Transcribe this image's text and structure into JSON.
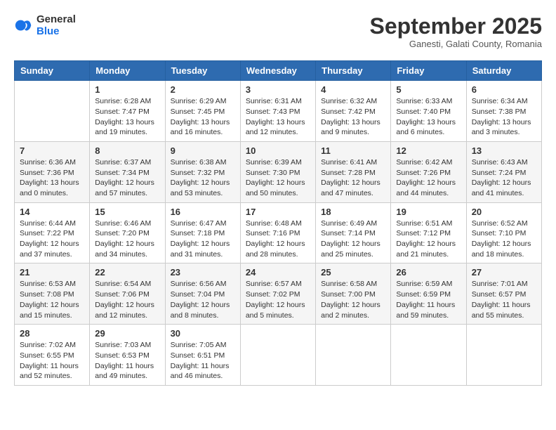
{
  "logo": {
    "general": "General",
    "blue": "Blue"
  },
  "title": "September 2025",
  "subtitle": "Ganesti, Galati County, Romania",
  "days_of_week": [
    "Sunday",
    "Monday",
    "Tuesday",
    "Wednesday",
    "Thursday",
    "Friday",
    "Saturday"
  ],
  "weeks": [
    [
      {
        "day": "",
        "info": ""
      },
      {
        "day": "1",
        "info": "Sunrise: 6:28 AM\nSunset: 7:47 PM\nDaylight: 13 hours\nand 19 minutes."
      },
      {
        "day": "2",
        "info": "Sunrise: 6:29 AM\nSunset: 7:45 PM\nDaylight: 13 hours\nand 16 minutes."
      },
      {
        "day": "3",
        "info": "Sunrise: 6:31 AM\nSunset: 7:43 PM\nDaylight: 13 hours\nand 12 minutes."
      },
      {
        "day": "4",
        "info": "Sunrise: 6:32 AM\nSunset: 7:42 PM\nDaylight: 13 hours\nand 9 minutes."
      },
      {
        "day": "5",
        "info": "Sunrise: 6:33 AM\nSunset: 7:40 PM\nDaylight: 13 hours\nand 6 minutes."
      },
      {
        "day": "6",
        "info": "Sunrise: 6:34 AM\nSunset: 7:38 PM\nDaylight: 13 hours\nand 3 minutes."
      }
    ],
    [
      {
        "day": "7",
        "info": "Sunrise: 6:36 AM\nSunset: 7:36 PM\nDaylight: 13 hours\nand 0 minutes."
      },
      {
        "day": "8",
        "info": "Sunrise: 6:37 AM\nSunset: 7:34 PM\nDaylight: 12 hours\nand 57 minutes."
      },
      {
        "day": "9",
        "info": "Sunrise: 6:38 AM\nSunset: 7:32 PM\nDaylight: 12 hours\nand 53 minutes."
      },
      {
        "day": "10",
        "info": "Sunrise: 6:39 AM\nSunset: 7:30 PM\nDaylight: 12 hours\nand 50 minutes."
      },
      {
        "day": "11",
        "info": "Sunrise: 6:41 AM\nSunset: 7:28 PM\nDaylight: 12 hours\nand 47 minutes."
      },
      {
        "day": "12",
        "info": "Sunrise: 6:42 AM\nSunset: 7:26 PM\nDaylight: 12 hours\nand 44 minutes."
      },
      {
        "day": "13",
        "info": "Sunrise: 6:43 AM\nSunset: 7:24 PM\nDaylight: 12 hours\nand 41 minutes."
      }
    ],
    [
      {
        "day": "14",
        "info": "Sunrise: 6:44 AM\nSunset: 7:22 PM\nDaylight: 12 hours\nand 37 minutes."
      },
      {
        "day": "15",
        "info": "Sunrise: 6:46 AM\nSunset: 7:20 PM\nDaylight: 12 hours\nand 34 minutes."
      },
      {
        "day": "16",
        "info": "Sunrise: 6:47 AM\nSunset: 7:18 PM\nDaylight: 12 hours\nand 31 minutes."
      },
      {
        "day": "17",
        "info": "Sunrise: 6:48 AM\nSunset: 7:16 PM\nDaylight: 12 hours\nand 28 minutes."
      },
      {
        "day": "18",
        "info": "Sunrise: 6:49 AM\nSunset: 7:14 PM\nDaylight: 12 hours\nand 25 minutes."
      },
      {
        "day": "19",
        "info": "Sunrise: 6:51 AM\nSunset: 7:12 PM\nDaylight: 12 hours\nand 21 minutes."
      },
      {
        "day": "20",
        "info": "Sunrise: 6:52 AM\nSunset: 7:10 PM\nDaylight: 12 hours\nand 18 minutes."
      }
    ],
    [
      {
        "day": "21",
        "info": "Sunrise: 6:53 AM\nSunset: 7:08 PM\nDaylight: 12 hours\nand 15 minutes."
      },
      {
        "day": "22",
        "info": "Sunrise: 6:54 AM\nSunset: 7:06 PM\nDaylight: 12 hours\nand 12 minutes."
      },
      {
        "day": "23",
        "info": "Sunrise: 6:56 AM\nSunset: 7:04 PM\nDaylight: 12 hours\nand 8 minutes."
      },
      {
        "day": "24",
        "info": "Sunrise: 6:57 AM\nSunset: 7:02 PM\nDaylight: 12 hours\nand 5 minutes."
      },
      {
        "day": "25",
        "info": "Sunrise: 6:58 AM\nSunset: 7:00 PM\nDaylight: 12 hours\nand 2 minutes."
      },
      {
        "day": "26",
        "info": "Sunrise: 6:59 AM\nSunset: 6:59 PM\nDaylight: 11 hours\nand 59 minutes."
      },
      {
        "day": "27",
        "info": "Sunrise: 7:01 AM\nSunset: 6:57 PM\nDaylight: 11 hours\nand 55 minutes."
      }
    ],
    [
      {
        "day": "28",
        "info": "Sunrise: 7:02 AM\nSunset: 6:55 PM\nDaylight: 11 hours\nand 52 minutes."
      },
      {
        "day": "29",
        "info": "Sunrise: 7:03 AM\nSunset: 6:53 PM\nDaylight: 11 hours\nand 49 minutes."
      },
      {
        "day": "30",
        "info": "Sunrise: 7:05 AM\nSunset: 6:51 PM\nDaylight: 11 hours\nand 46 minutes."
      },
      {
        "day": "",
        "info": ""
      },
      {
        "day": "",
        "info": ""
      },
      {
        "day": "",
        "info": ""
      },
      {
        "day": "",
        "info": ""
      }
    ]
  ]
}
